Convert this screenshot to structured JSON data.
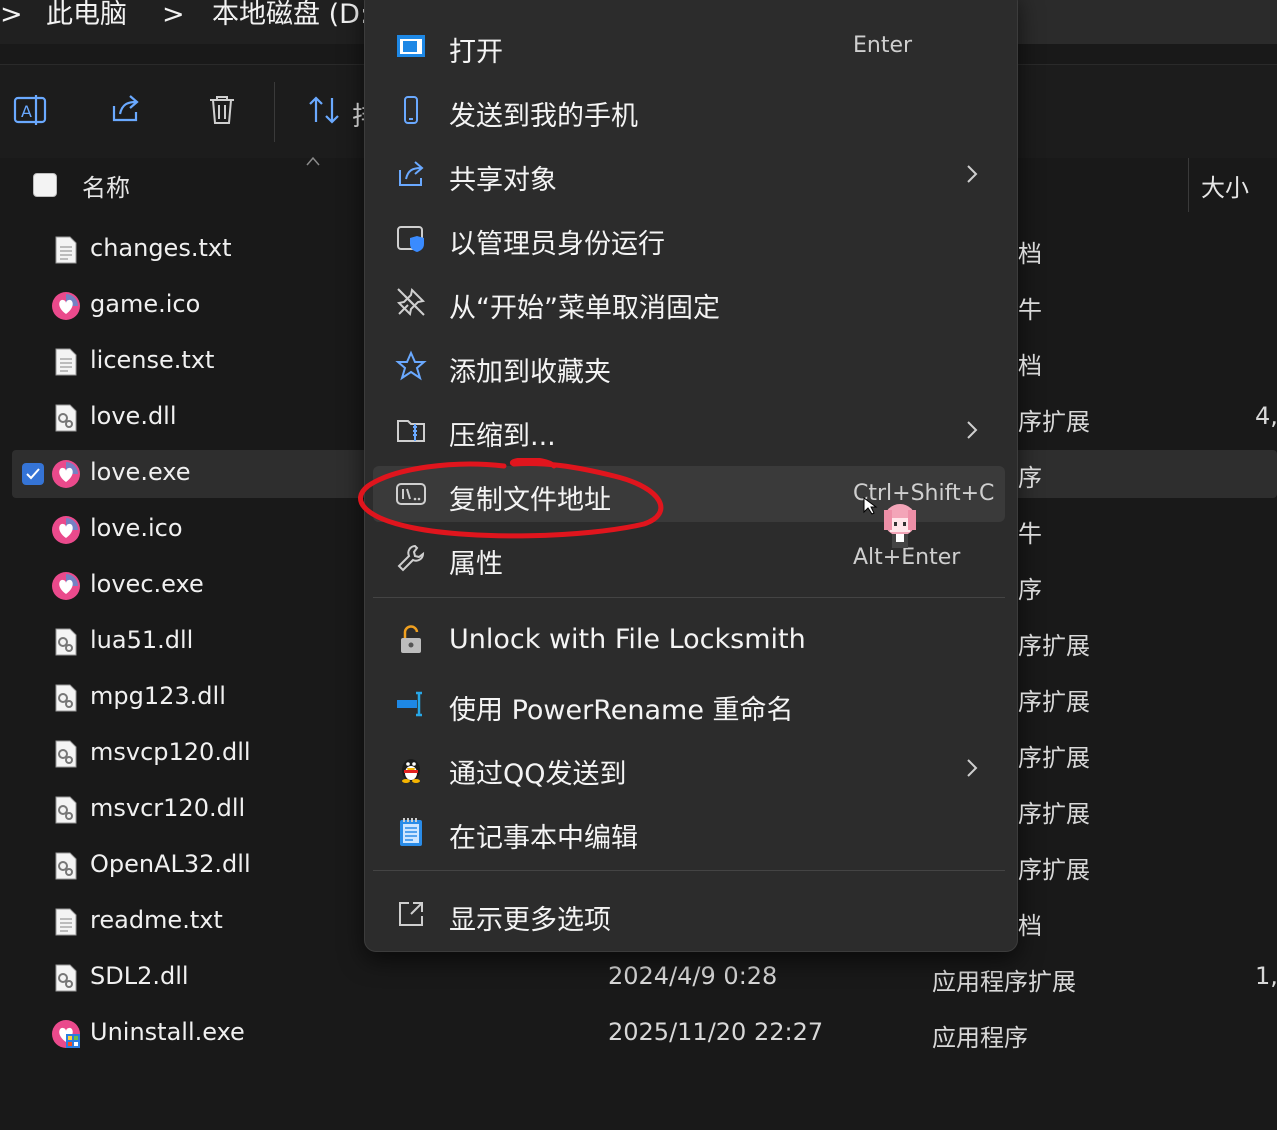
{
  "breadcrumb": {
    "chevron_left": ">",
    "this_pc": "此电脑",
    "sep": ">",
    "drive": "本地磁盘 (D:"
  },
  "toolbar": {
    "sort_partial": "排"
  },
  "header": {
    "name": "名称",
    "size": "大小"
  },
  "files": [
    {
      "name": "changes.txt",
      "icon": "text-file-icon",
      "type_peek": "档",
      "size_peek": ""
    },
    {
      "name": "game.ico",
      "icon": "love-heart-icon",
      "type_peek": "牛",
      "size_peek": ""
    },
    {
      "name": "license.txt",
      "icon": "text-file-icon",
      "type_peek": "档",
      "size_peek": ""
    },
    {
      "name": "love.dll",
      "icon": "dll-file-icon",
      "type_peek": "序扩展",
      "size_peek": "4,"
    },
    {
      "name": "love.exe",
      "icon": "love-heart-icon",
      "type_peek": "序",
      "size_peek": "",
      "selected": true
    },
    {
      "name": "love.ico",
      "icon": "love-heart-icon",
      "type_peek": "牛",
      "size_peek": ""
    },
    {
      "name": "lovec.exe",
      "icon": "love-heart-icon",
      "type_peek": "序",
      "size_peek": ""
    },
    {
      "name": "lua51.dll",
      "icon": "dll-file-icon",
      "type_peek": "序扩展",
      "size_peek": ""
    },
    {
      "name": "mpg123.dll",
      "icon": "dll-file-icon",
      "type_peek": "序扩展",
      "size_peek": ""
    },
    {
      "name": "msvcp120.dll",
      "icon": "dll-file-icon",
      "type_peek": "序扩展",
      "size_peek": ""
    },
    {
      "name": "msvcr120.dll",
      "icon": "dll-file-icon",
      "type_peek": "序扩展",
      "size_peek": ""
    },
    {
      "name": "OpenAL32.dll",
      "icon": "dll-file-icon",
      "type_peek": "序扩展",
      "size_peek": ""
    },
    {
      "name": "readme.txt",
      "icon": "text-file-icon",
      "type_peek": "档",
      "size_peek": ""
    },
    {
      "name": "SDL2.dll",
      "icon": "dll-file-icon",
      "date": "2024/4/9 0:28",
      "type": "应用程序扩展",
      "size": "1,"
    },
    {
      "name": "Uninstall.exe",
      "icon": "uninstall-icon",
      "date": "2025/11/20 22:27",
      "type": "应用程序",
      "size": ""
    }
  ],
  "menu": {
    "items": [
      {
        "label": "打开",
        "shortcut": "Enter",
        "icon": "open-window-icon"
      },
      {
        "label": "发送到我的手机",
        "icon": "phone-icon"
      },
      {
        "label": "共享对象",
        "icon": "share-icon",
        "submenu": true
      },
      {
        "label": "以管理员身份运行",
        "icon": "admin-shield-icon"
      },
      {
        "label": "从“开始”菜单取消固定",
        "icon": "unpin-icon"
      },
      {
        "label": "添加到收藏夹",
        "icon": "star-icon"
      },
      {
        "label": "压缩到...",
        "icon": "zip-folder-icon",
        "submenu": true
      },
      {
        "label": "复制文件地址",
        "shortcut": "Ctrl+Shift+C",
        "icon": "copy-path-icon",
        "hover": true
      },
      {
        "label": "属性",
        "shortcut": "Alt+Enter",
        "icon": "wrench-icon"
      },
      {
        "label": "Unlock with File Locksmith",
        "icon": "lock-icon"
      },
      {
        "label": "使用 PowerRename 重命名",
        "icon": "power-rename-icon"
      },
      {
        "label": "通过QQ发送到",
        "icon": "qq-penguin-icon",
        "submenu": true
      },
      {
        "label": "在记事本中编辑",
        "icon": "notepad-icon"
      },
      {
        "label": "显示更多选项",
        "icon": "more-options-icon"
      }
    ]
  },
  "colors": {
    "accent": "#3574d6",
    "highlight_red": "#e0151d",
    "love_pink": "#ea4a8c",
    "love_blue": "#27a7e7"
  }
}
